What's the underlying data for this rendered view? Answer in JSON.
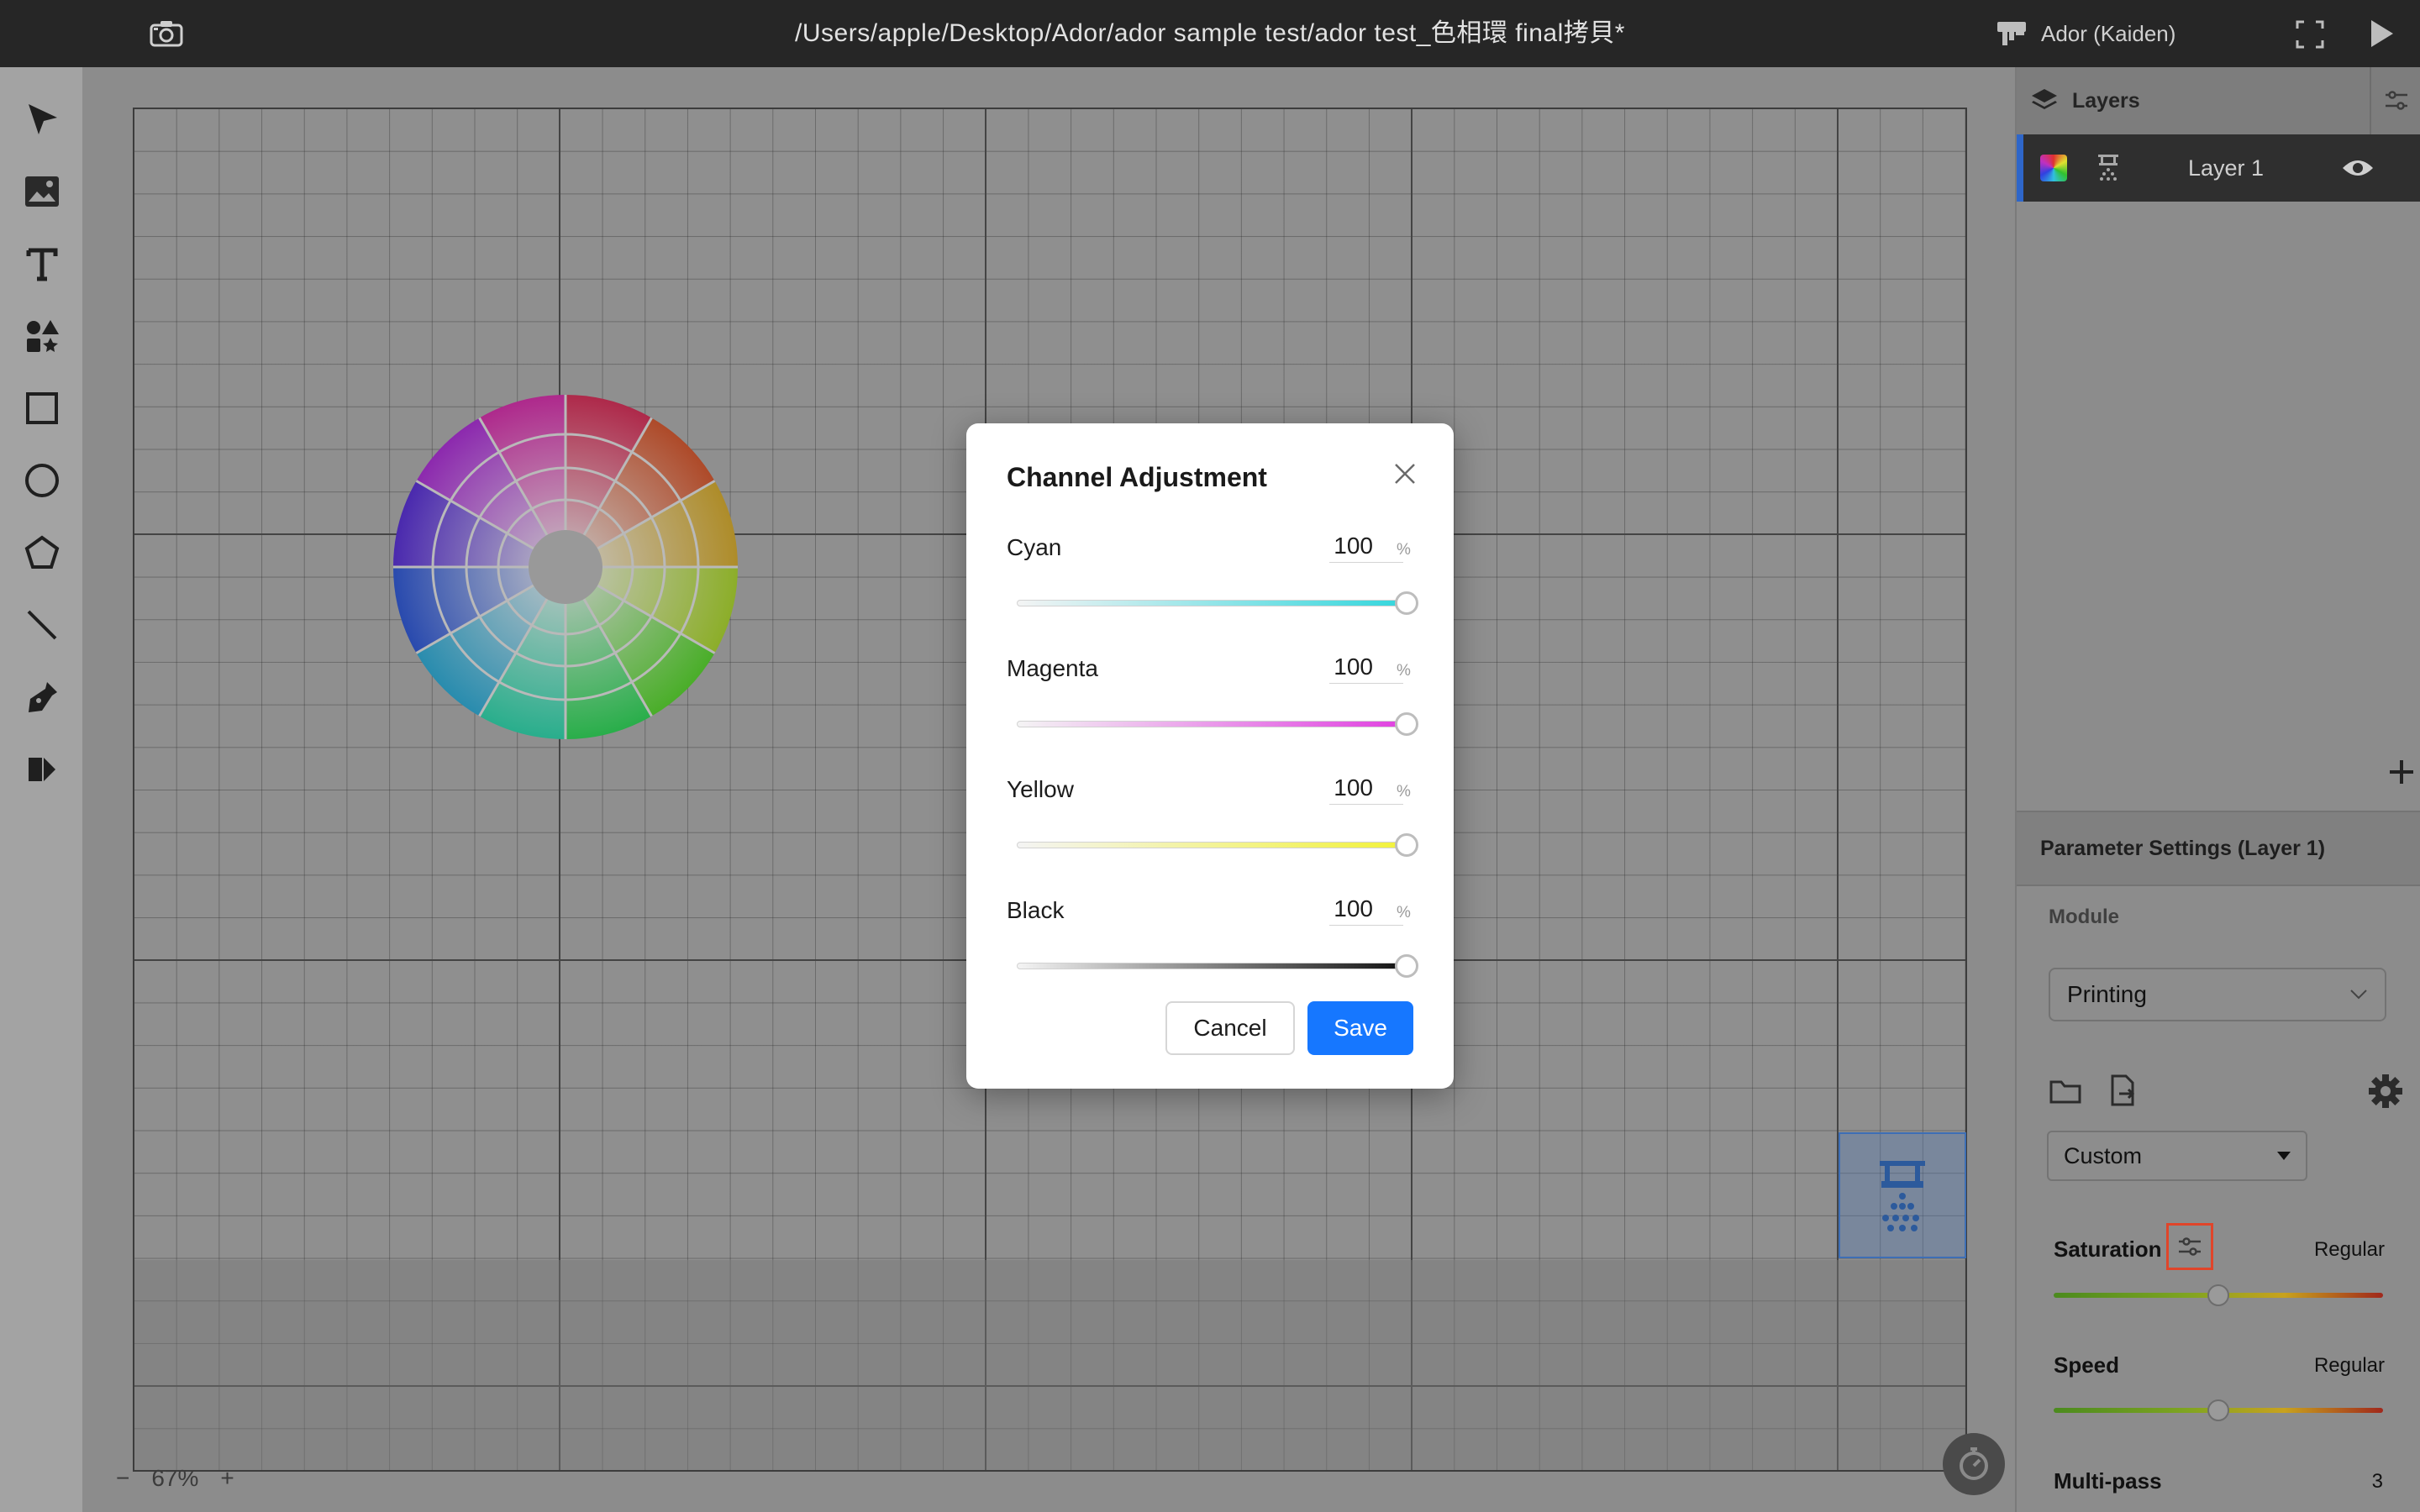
{
  "app": {
    "window_title": "/Users/apple/Desktop/Ador/ador sample test/ador test_色相環 final拷貝*",
    "device_name": "Ador (Kaiden)"
  },
  "toolbar": {
    "tools": [
      "select-tool",
      "image-tool",
      "text-tool",
      "element-tool",
      "rectangle-tool",
      "ellipse-tool",
      "polygon-tool",
      "line-tool",
      "pen-tool",
      "dmkt-tool"
    ]
  },
  "canvas": {
    "zoom_label": "67%",
    "zoom_minus": "−",
    "zoom_plus": "+"
  },
  "layers_panel": {
    "title": "Layers",
    "layers": [
      {
        "name": "Layer 1",
        "visible": true
      }
    ]
  },
  "parameters": {
    "header": "Parameter Settings (Layer 1)",
    "module_label": "Module",
    "module_value": "Printing",
    "preset_value": "Custom",
    "saturation_label": "Saturation",
    "saturation_value": "Regular",
    "saturation_level": 0.5,
    "speed_label": "Speed",
    "speed_value": "Regular",
    "speed_level": 0.5,
    "multipass_label": "Multi-pass",
    "multipass_value": "3"
  },
  "dialog": {
    "title": "Channel Adjustment",
    "channels": [
      {
        "label": "Cyan",
        "value": "100",
        "unit": "%",
        "color": "#33d6dc"
      },
      {
        "label": "Magenta",
        "value": "100",
        "unit": "%",
        "color": "#e040e0"
      },
      {
        "label": "Yellow",
        "value": "100",
        "unit": "%",
        "color": "#f2f23a"
      },
      {
        "label": "Black",
        "value": "100",
        "unit": "%",
        "color": "#111111"
      }
    ],
    "cancel_label": "Cancel",
    "save_label": "Save"
  },
  "colors": {
    "accent": "#1677ff",
    "highlight_box": "#e0452a"
  }
}
